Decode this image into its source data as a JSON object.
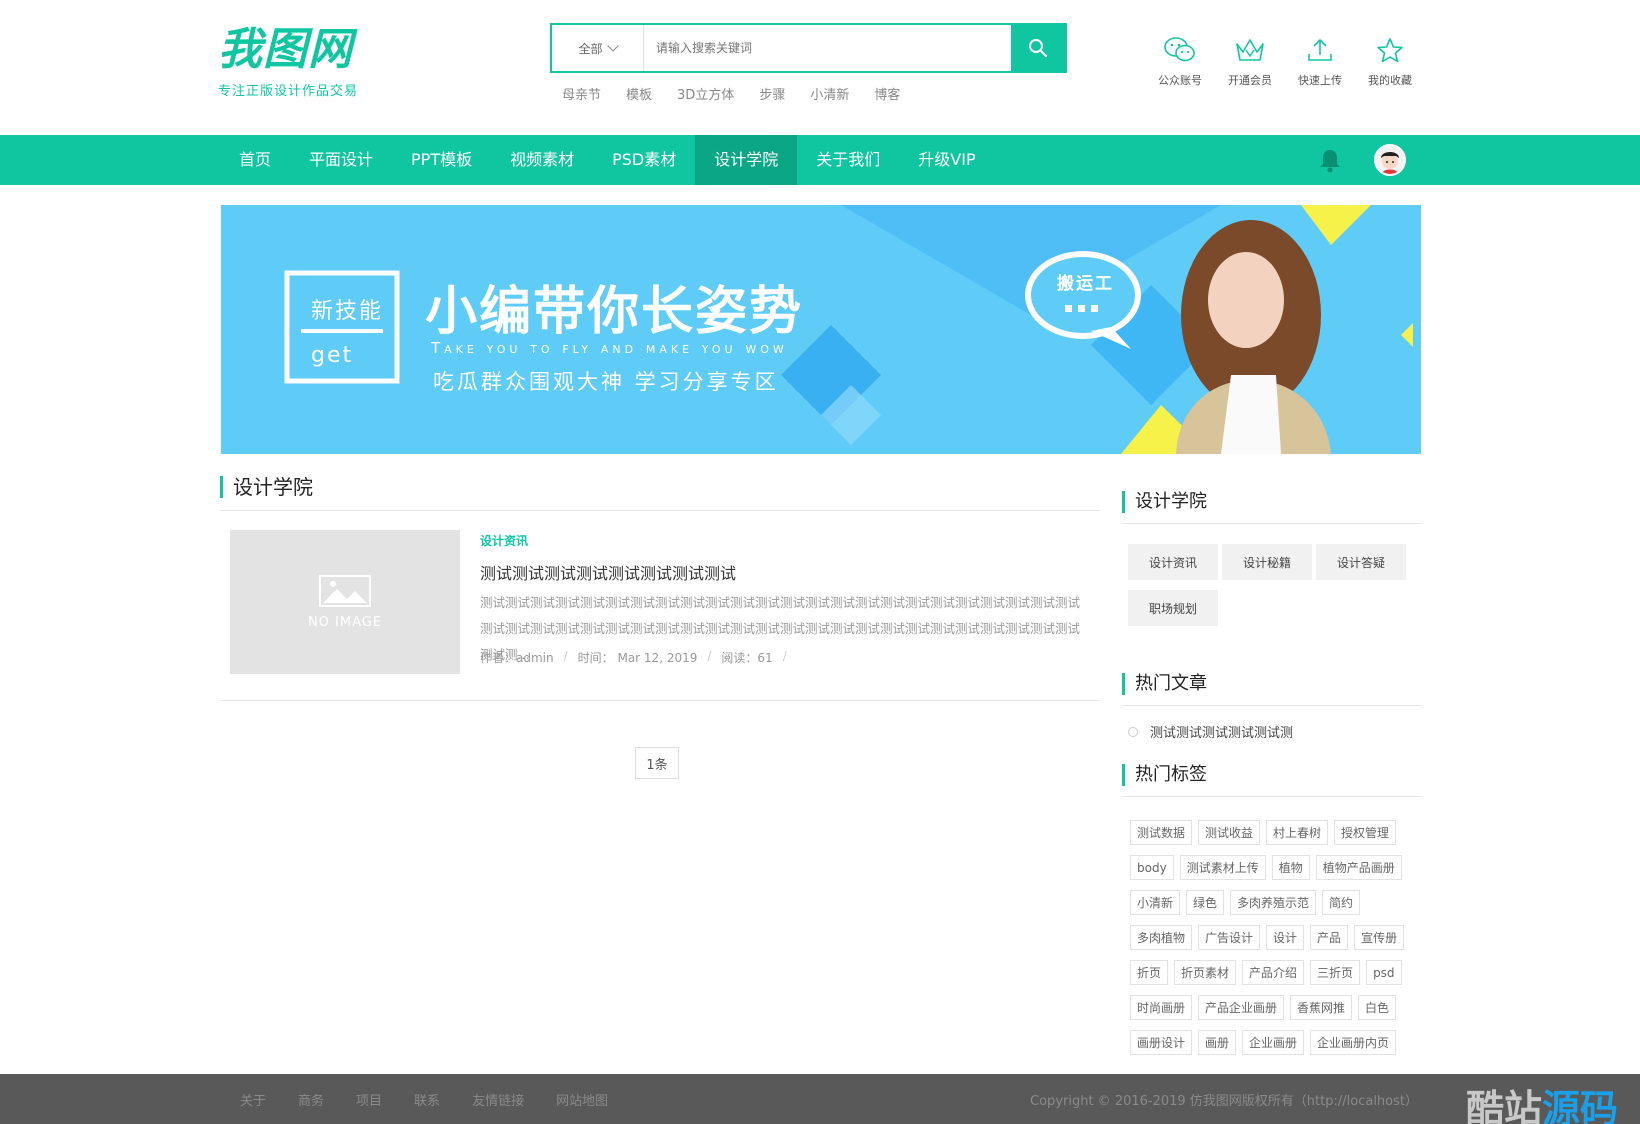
{
  "header": {
    "logo_text": "我图网",
    "logo_sub": "专注正版设计作品交易",
    "search": {
      "category": "全部",
      "placeholder": "请输入搜索关键词"
    },
    "hot_words": [
      "母亲节",
      "模板",
      "3D立方体",
      "步骤",
      "小清新",
      "博客"
    ],
    "quick_links": [
      {
        "label": "公众账号",
        "icon": "wechat-icon"
      },
      {
        "label": "开通会员",
        "icon": "crown-icon"
      },
      {
        "label": "快速上传",
        "icon": "upload-icon"
      },
      {
        "label": "我的收藏",
        "icon": "star-icon"
      }
    ]
  },
  "nav": {
    "items": [
      "首页",
      "平面设计",
      "PPT模板",
      "视频素材",
      "PSD素材",
      "设计学院",
      "关于我们",
      "升级VIP"
    ],
    "active_index": 5
  },
  "banner": {
    "badge_top": "新技能",
    "badge_bottom": "get",
    "headline": "小编带你长姿势",
    "subline_en": "Take you to fly and make you wow",
    "subline_cn": "吃瓜群众围观大神 学习分享专区",
    "bubble_text": "搬运工"
  },
  "main": {
    "title": "设计学院",
    "article": {
      "category": "设计资讯",
      "title": "测试测试测试测试测试测试测试测试",
      "desc": "测试测试测试测试测试测试测试测试测试测试测试测试测试测试测试测试测试测试测试测试测试测试测试测试测试测试测试测试测试测试测试测试测试测试测试测试测试测试测试测试测试测试测试测试测试测试测试测试测试测...",
      "thumb_text": "NO IMAGE",
      "author": "作者：admin",
      "time": "时间： Mar 12, 2019",
      "reads": "阅读：61"
    },
    "pager": "1条"
  },
  "sidebar": {
    "cat_title": "设计学院",
    "categories": [
      "设计资讯",
      "设计秘籍",
      "设计答疑",
      "职场规划"
    ],
    "hot_title": "热门文章",
    "hot_articles": [
      "测试测试测试测试测试测"
    ],
    "tags_title": "热门标签",
    "tags": [
      "测试数据",
      "测试收益",
      "村上春树",
      "授权管理",
      "body",
      "测试素材上传",
      "植物",
      "植物产品画册",
      "小清新",
      "绿色",
      "多肉养殖示范",
      "简约",
      "多肉植物",
      "广告设计",
      "设计",
      "产品",
      "宣传册",
      "折页",
      "折页素材",
      "产品介绍",
      "三折页",
      "psd",
      "时尚画册",
      "产品企业画册",
      "香蕉网推",
      "白色",
      "画册设计",
      "画册",
      "企业画册",
      "企业画册内页"
    ]
  },
  "footer": {
    "links": [
      "关于",
      "商务",
      "项目",
      "联系",
      "友情链接",
      "网站地图"
    ],
    "copyright": "Copyright © 2016-2019 仿我图网版权所有（http://localhost）",
    "watermark_a": "酷站",
    "watermark_b": "源码"
  },
  "colors": {
    "accent": "#0fc6a1",
    "accent_dark": "#0aa686",
    "banner_bg": "#5fcbf7",
    "footer_bg": "#595959"
  }
}
